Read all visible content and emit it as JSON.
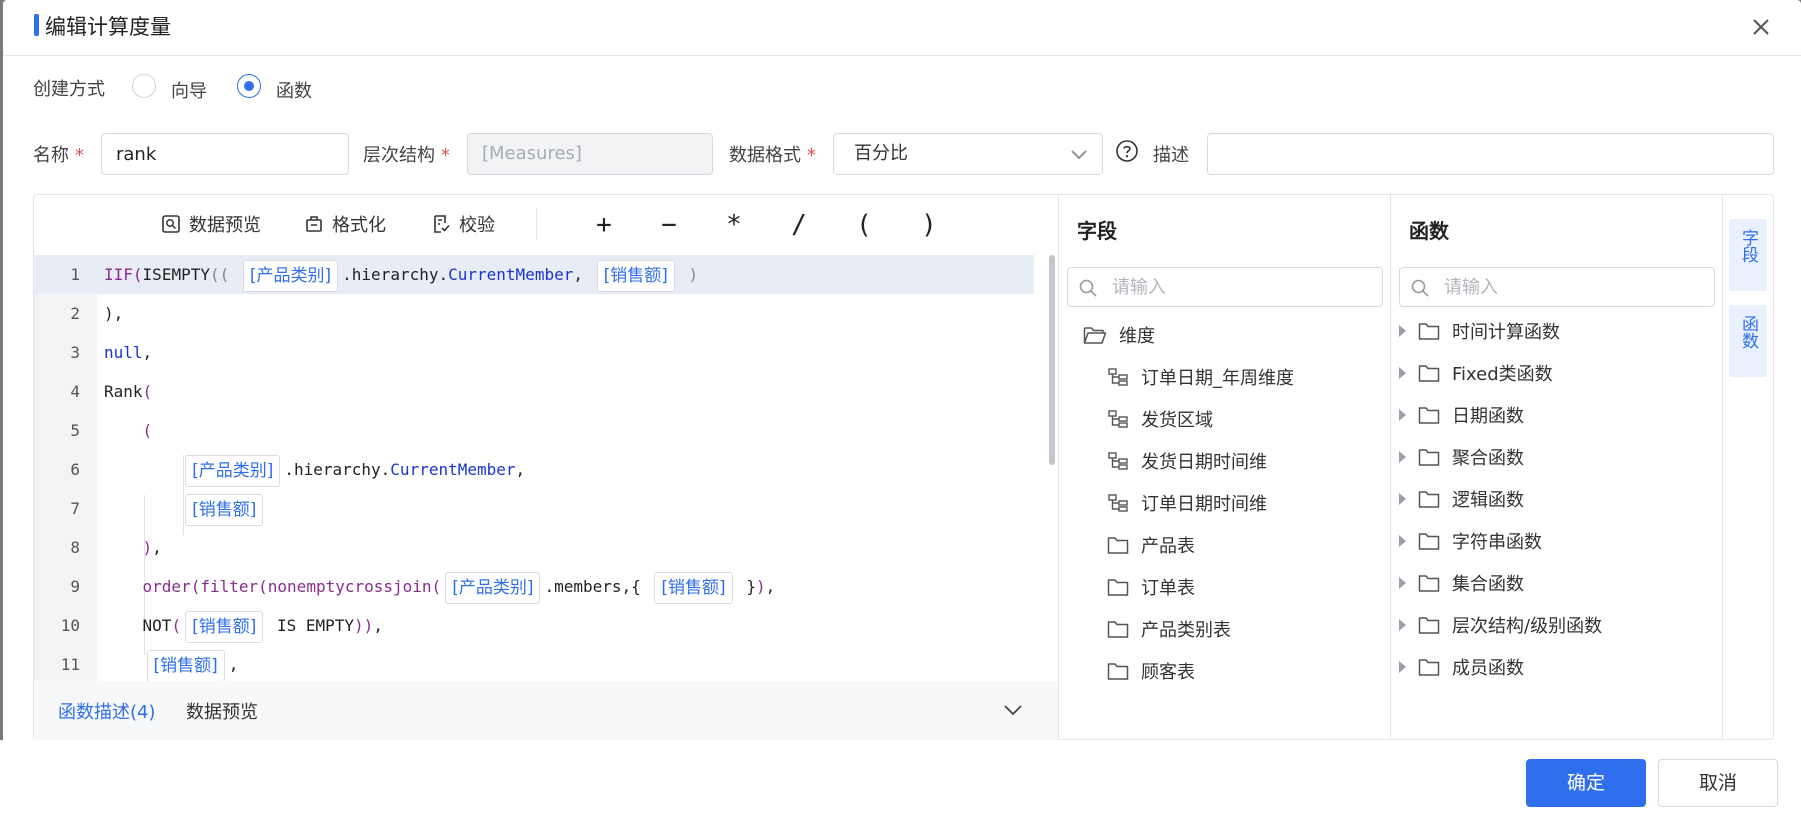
{
  "dialog": {
    "title": "编辑计算度量",
    "confirm_label": "确定",
    "cancel_label": "取消"
  },
  "create_mode": {
    "label": "创建方式",
    "options": [
      {
        "label": "向导",
        "checked": false
      },
      {
        "label": "函数",
        "checked": true
      }
    ]
  },
  "form": {
    "name_label": "名称",
    "name_value": "rank",
    "hierarchy_label": "层次结构",
    "hierarchy_value": "[Measures]",
    "format_label": "数据格式",
    "format_value": "百分比",
    "desc_label": "描述",
    "desc_value": "",
    "required_mark": "*"
  },
  "toolbar": {
    "preview_label": "数据预览",
    "format_label": "格式化",
    "validate_label": "校验",
    "operators": [
      "+",
      "−",
      "*",
      "/",
      "(",
      ")"
    ]
  },
  "code": {
    "line_numbers": [
      "1",
      "2",
      "3",
      "4",
      "5",
      "6",
      "7",
      "8",
      "9",
      "10",
      "11"
    ],
    "tags": {
      "category": "[产品类别]",
      "sales": "[销售额]"
    },
    "tokens": {
      "iif": "IIF",
      "isempty": "ISEMPTY",
      "hierarchy": ".hierarchy.",
      "current_member": "CurrentMember",
      "null": "null",
      "rank": "Rank",
      "order": "order",
      "filter": "filter",
      "nonemptycrossjoin": "nonemptycrossjoin",
      "members": ".members,{",
      "not": "NOT",
      "is_empty": "IS EMPTY"
    }
  },
  "bottom_tabs": {
    "func_desc": "函数描述(4)",
    "data_preview": "数据预览"
  },
  "fields_panel": {
    "title": "字段",
    "search_placeholder": "请输入",
    "root": "维度",
    "items": [
      {
        "label": "订单日期_年周维度",
        "icon": "hierarchy-icon"
      },
      {
        "label": "发货区域",
        "icon": "hierarchy-icon"
      },
      {
        "label": "发货日期时间维",
        "icon": "hierarchy-icon"
      },
      {
        "label": "订单日期时间维",
        "icon": "hierarchy-icon"
      },
      {
        "label": "产品表",
        "icon": "folder-icon"
      },
      {
        "label": "订单表",
        "icon": "folder-icon"
      },
      {
        "label": "产品类别表",
        "icon": "folder-icon"
      },
      {
        "label": "顾客表",
        "icon": "folder-icon"
      }
    ]
  },
  "functions_panel": {
    "title": "函数",
    "search_placeholder": "请输入",
    "items": [
      "时间计算函数",
      "Fixed类函数",
      "日期函数",
      "聚合函数",
      "逻辑函数",
      "字符串函数",
      "集合函数",
      "层次结构/级别函数",
      "成员函数"
    ]
  },
  "side_tabs": [
    "字段",
    "函数"
  ],
  "colors": {
    "accent": "#2f6fed",
    "required": "#e34d59",
    "keyword_fn": "#8a2c8f",
    "keyword_blue": "#1a33d6"
  }
}
